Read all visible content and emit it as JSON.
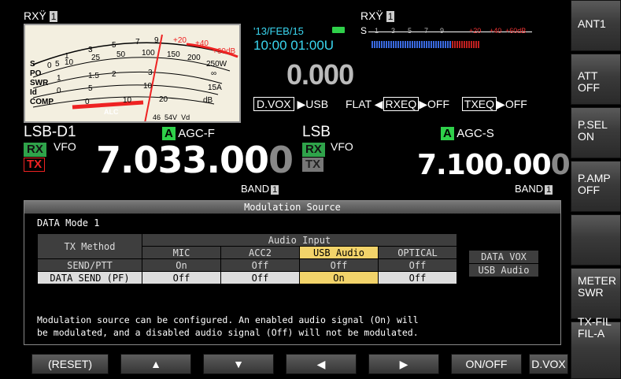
{
  "rx_left": "RX",
  "rx_left_num": "1",
  "rx_right": "RX",
  "rx_right_num": "1",
  "meter": {
    "rows": [
      "S",
      "PO",
      "SWR",
      "Id",
      "COMP"
    ],
    "scale_s": [
      "1",
      "3",
      "5",
      "7",
      "9",
      "+20",
      "+40",
      "+60dB"
    ],
    "scale_po": [
      "0",
      "5",
      "10",
      "25",
      "50",
      "100",
      "150",
      "200",
      "250W"
    ],
    "scale_swr": [
      "1",
      "1.5",
      "2",
      "3",
      "∞"
    ],
    "scale_id": [
      "0",
      "5",
      "10",
      "15A"
    ],
    "scale_comp": [
      "0",
      "10",
      "20",
      "dB"
    ],
    "alc": "ALC",
    "volt": [
      "46",
      "54V",
      "Vd"
    ]
  },
  "date": "'13/FEB/15",
  "time": "10:00 01:00U",
  "rit": "0.000",
  "dvox": "D.VOX",
  "usb_out": "USB",
  "flat": "FLAT",
  "rxeq": "RXEQ",
  "rxeq_state": "OFF",
  "txeq": "TXEQ",
  "txeq_state": "OFF",
  "s_meter": {
    "label": "S",
    "ticks": [
      "1",
      "3",
      "5",
      "7",
      "9",
      "+20",
      "+40",
      "+60dB"
    ]
  },
  "vfo_a": {
    "mode": "LSB-D1",
    "ant": "A",
    "agc": "AGC-F",
    "rx": "RX",
    "tx": "TX",
    "vfo": "VFO",
    "freq_main": "7.033.00",
    "freq_last": "0",
    "band": "BAND",
    "band_num": "1"
  },
  "vfo_b": {
    "mode": "LSB",
    "ant": "A",
    "agc": "AGC-S",
    "rx": "RX",
    "tx": "TX",
    "vfo": "VFO",
    "freq_main": "7.100.00",
    "freq_last": "0",
    "band": "BAND",
    "band_num": "1"
  },
  "softkeys": [
    {
      "l1": "ANT1",
      "l2": ""
    },
    {
      "l1": "ATT",
      "l2": "OFF"
    },
    {
      "l1": "P.SEL",
      "l2": "ON"
    },
    {
      "l1": "P.AMP",
      "l2": "OFF"
    },
    {
      "l1": "",
      "l2": ""
    },
    {
      "l1": "METER",
      "l2": "SWR"
    },
    {
      "l1": "TX-FIL",
      "l2": "FIL-A"
    }
  ],
  "bottom_keys": [
    "(RESET)",
    "▲",
    "▼",
    "◀",
    "▶",
    "ON/OFF",
    "D.VOX"
  ],
  "panel": {
    "title": "Modulation Source",
    "mode": "DATA Mode 1",
    "audio_input": "Audio Input",
    "tx_method": "TX Method",
    "cols": [
      "MIC",
      "ACC2",
      "USB Audio",
      "OPTICAL"
    ],
    "rows": [
      {
        "name": "SEND/PTT",
        "vals": [
          "On",
          "Off",
          "Off",
          "Off"
        ]
      },
      {
        "name": "DATA SEND (PF)",
        "vals": [
          "Off",
          "Off",
          "On",
          "Off"
        ]
      }
    ],
    "data_vox_label": "DATA VOX",
    "data_vox_value": "USB Audio",
    "desc1": "Modulation source can be configured. An enabled audio signal (On) will",
    "desc2": "be modulated, and a disabled audio signal (Off) will not be modulated."
  }
}
